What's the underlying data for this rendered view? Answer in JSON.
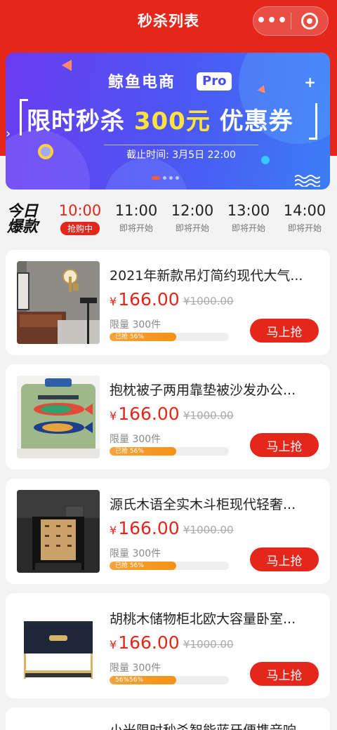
{
  "nav": {
    "title": "秒杀列表",
    "more_label": "•••"
  },
  "banner": {
    "brand": "鲸鱼电商",
    "pro_badge": "Pro",
    "headline_prefix": "限时秒杀",
    "headline_amount": "300元",
    "headline_suffix": "优惠券",
    "deadline": "截止时间:  3月5日 22:00"
  },
  "today": {
    "line1": "今日",
    "line2": "爆款"
  },
  "time_slots": [
    {
      "time": "10:00",
      "status": "抢购中",
      "active": true
    },
    {
      "time": "11:00",
      "status": "即将开始",
      "active": false
    },
    {
      "time": "12:00",
      "status": "即将开始",
      "active": false
    },
    {
      "time": "13:00",
      "status": "即将开始",
      "active": false
    },
    {
      "time": "14:00",
      "status": "即将开始",
      "active": false
    }
  ],
  "products": [
    {
      "name": "2021年新款吊灯简约现代大气...",
      "currency": "¥",
      "price": "166.00",
      "original_price": "¥1000.00",
      "limit": "限量 300件",
      "progress_text": "已抢 56%",
      "progress": 0.56,
      "button": "马上抢"
    },
    {
      "name": "抱枕被子两用靠垫被沙发办公...",
      "currency": "¥",
      "price": "166.00",
      "original_price": "¥1000.00",
      "limit": "限量 300件",
      "progress_text": "已抢 56%",
      "progress": 0.56,
      "button": "马上抢"
    },
    {
      "name": "源氏木语全实木斗柜现代轻奢...",
      "currency": "¥",
      "price": "166.00",
      "original_price": "¥1000.00",
      "limit": "限量 300件",
      "progress_text": "已抢 56%",
      "progress": 0.56,
      "button": "马上抢"
    },
    {
      "name": "胡桃木储物柜北欧大容量卧室...",
      "currency": "¥",
      "price": "166.00",
      "original_price": "¥1000.00",
      "limit": "限量 300件",
      "progress_text": "56%56%",
      "progress": 0.56,
      "button": "马上抢"
    },
    {
      "name": "小米限时秒杀智能蓝牙便携音响"
    }
  ],
  "colors": {
    "primary": "#e5261b",
    "progress": "#f39214"
  }
}
